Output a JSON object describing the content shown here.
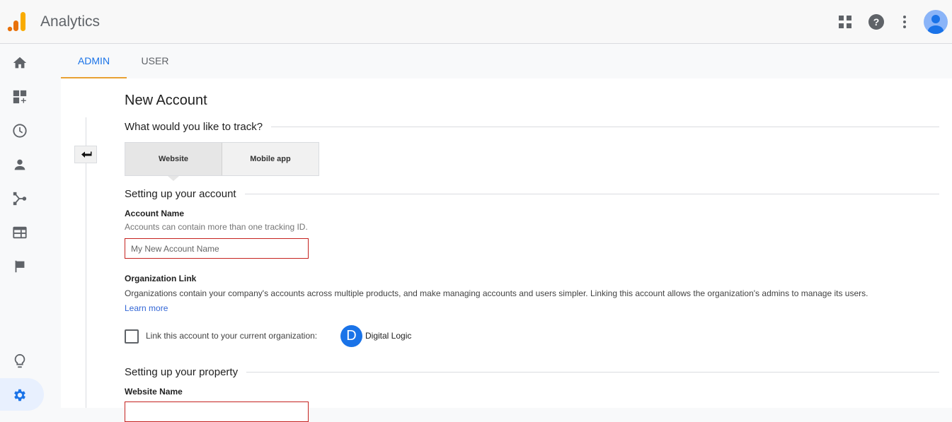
{
  "header": {
    "app_title": "Analytics",
    "icons": [
      "apps-grid-icon",
      "help-icon",
      "more-vert-icon",
      "account-avatar-icon"
    ]
  },
  "sidebar": {
    "items": [
      {
        "name": "home",
        "icon": "home-icon"
      },
      {
        "name": "customization",
        "icon": "dashboard-add-icon"
      },
      {
        "name": "realtime",
        "icon": "clock-icon"
      },
      {
        "name": "audience",
        "icon": "person-icon"
      },
      {
        "name": "acquisition",
        "icon": "acquisition-icon"
      },
      {
        "name": "behavior",
        "icon": "behavior-icon"
      },
      {
        "name": "conversions",
        "icon": "flag-icon"
      },
      {
        "name": "discover",
        "icon": "lightbulb-icon"
      },
      {
        "name": "admin",
        "icon": "gear-icon",
        "active": true
      }
    ]
  },
  "tabs": [
    {
      "label": "ADMIN",
      "active": true
    },
    {
      "label": "USER",
      "active": false
    }
  ],
  "form": {
    "title": "New Account",
    "track_question": "What would you like to track?",
    "track_options": [
      {
        "label": "Website",
        "selected": true
      },
      {
        "label": "Mobile app",
        "selected": false
      }
    ],
    "account_section": "Setting up your account",
    "account_name_label": "Account Name",
    "account_name_hint": "Accounts can contain more than one tracking ID.",
    "account_name_value": "",
    "account_name_placeholder": "My New Account Name",
    "org_link_label": "Organization Link",
    "org_link_desc": "Organizations contain your company's accounts across multiple products, and make managing accounts and users simpler. Linking this account allows the organization's admins to manage its users.",
    "learn_more": "Learn more",
    "link_checkbox_label": "Link this account to your current organization:",
    "link_checked": false,
    "org_initial": "D",
    "org_name": "Digital Logic",
    "property_section": "Setting up your property",
    "website_name_label": "Website Name",
    "website_name_value": ""
  },
  "colors": {
    "accent": "#1a73e8",
    "tab_indicator": "#e8a133",
    "error_border": "#c5221f",
    "logo_orange": "#e8710a",
    "logo_yellow": "#f9ab00"
  }
}
